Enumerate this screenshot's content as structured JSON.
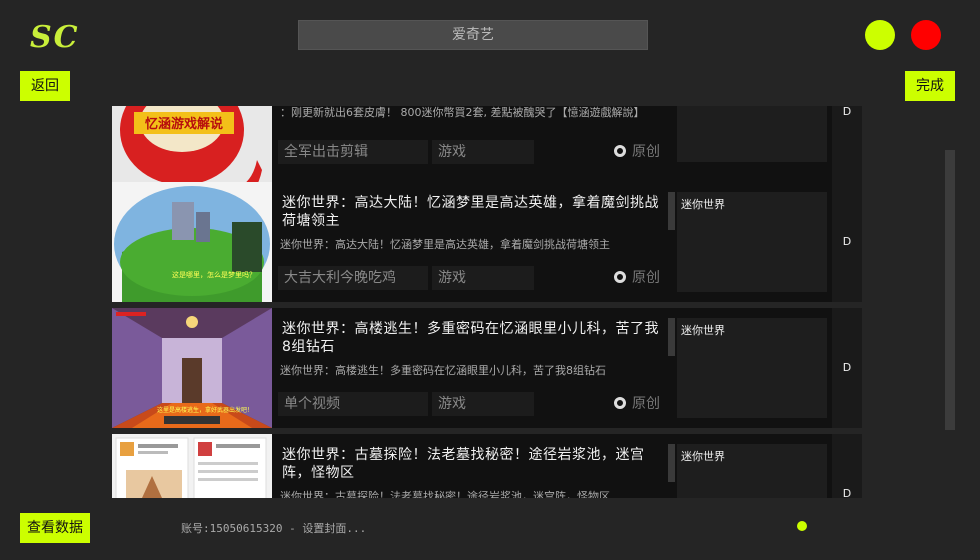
{
  "header": {
    "logo": "SC",
    "search_text": "爱奇艺",
    "back_label": "返回",
    "done_label": "完成"
  },
  "footer": {
    "view_data_label": "查看数据",
    "account_text": "账号:15050615320 - 设置封面..."
  },
  "rows": [
    {
      "title": "",
      "subtitle": "：刚更新就出6套皮膚！ 800迷你幣買2套, 差點被醜哭了【憶涵遊戲解說】",
      "category": "全军出击剪辑",
      "type": "游戏",
      "original_label": "原创",
      "tag": "",
      "d_label": "D"
    },
    {
      "title": "迷你世界：高达大陆！忆涵梦里是高达英雄，拿着魔剑挑战荷塘领主",
      "subtitle": "迷你世界：高达大陆！忆涵梦里是高达英雄，拿着魔剑挑战荷塘领主",
      "category": "大吉大利今晚吃鸡",
      "type": "游戏",
      "original_label": "原创",
      "tag": "迷你世界",
      "d_label": "D"
    },
    {
      "title": "迷你世界：高楼逃生！多重密码在忆涵眼里小儿科，苦了我8组钻石",
      "subtitle": "迷你世界：高楼逃生！多重密码在忆涵眼里小儿科，苦了我8组钻石",
      "category": "单个视频",
      "type": "游戏",
      "original_label": "原创",
      "tag": "迷你世界",
      "d_label": "D"
    },
    {
      "title": "迷你世界：古墓探险！法老墓找秘密！途径岩浆池，迷宫阵，怪物区",
      "subtitle": "迷你世界：古墓探险！法老墓找秘密！途径岩浆池，迷宫阵，怪物区",
      "category": "",
      "type": "",
      "original_label": "",
      "tag": "迷你世界",
      "d_label": "D"
    }
  ]
}
